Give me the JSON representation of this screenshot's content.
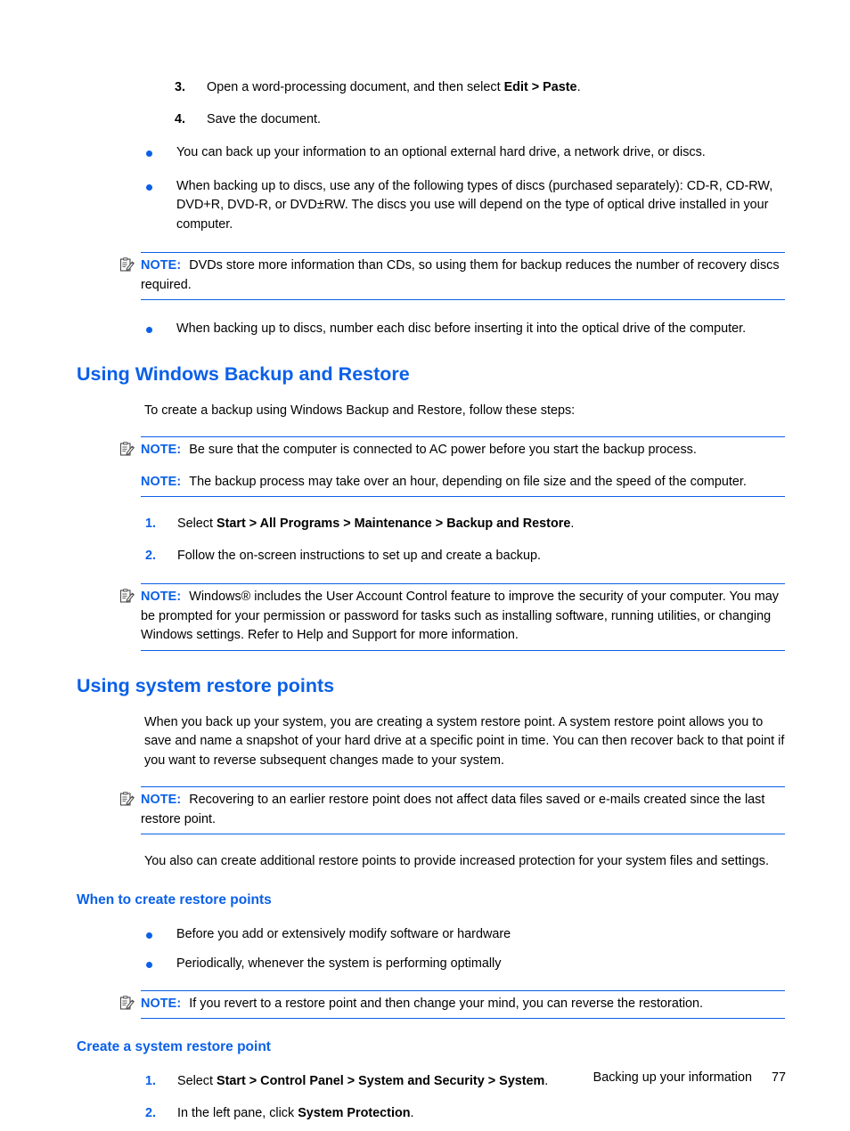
{
  "page": {
    "number": "77",
    "footer_title": "Backing up your information"
  },
  "top_steps": [
    {
      "marker": "3.",
      "text_before": "Open a word-processing document, and then select ",
      "bold": "Edit > Paste",
      "text_after": "."
    },
    {
      "marker": "4.",
      "text_before": "Save the document.",
      "bold": "",
      "text_after": ""
    }
  ],
  "top_bullets": [
    "You can back up your information to an optional external hard drive, a network drive, or discs.",
    "When backing up to discs, use any of the following types of discs (purchased separately): CD-R, CD-RW, DVD+R, DVD-R, or DVD±RW. The discs you use will depend on the type of optical drive installed in your computer."
  ],
  "note_dvd": {
    "label": "NOTE:",
    "text": "DVDs store more information than CDs, so using them for backup reduces the number of recovery discs required.",
    "icon": "note-pencil-icon"
  },
  "bullet_after_note": "When backing up to discs, number each disc before inserting it into the optical drive of the computer.",
  "section_backup_restore": {
    "heading": "Using Windows Backup and Restore",
    "intro": "To create a backup using Windows Backup and Restore, follow these steps:",
    "notes": [
      {
        "label": "NOTE:",
        "text": "Be sure that the computer is connected to AC power before you start the backup process."
      },
      {
        "label": "NOTE:",
        "text": "The backup process may take over an hour, depending on file size and the speed of the computer."
      }
    ],
    "steps": [
      {
        "marker": "1.",
        "text_before": "Select ",
        "bold": "Start > All Programs > Maintenance > Backup and Restore",
        "text_after": "."
      },
      {
        "marker": "2.",
        "text_before": "Follow the on-screen instructions to set up and create a backup.",
        "bold": "",
        "text_after": ""
      }
    ],
    "note_uac": {
      "label": "NOTE:",
      "text": "Windows® includes the User Account Control feature to improve the security of your computer. You may be prompted for your permission or password for tasks such as installing software, running utilities, or changing Windows settings. Refer to Help and Support for more information."
    }
  },
  "section_restore_points": {
    "heading": "Using system restore points",
    "paragraph_1": "When you back up your system, you are creating a system restore point. A system restore point allows you to save and name a snapshot of your hard drive at a specific point in time. You can then recover back to that point if you want to reverse subsequent changes made to your system.",
    "note": {
      "label": "NOTE:",
      "text": "Recovering to an earlier restore point does not affect data files saved or e-mails created since the last restore point."
    },
    "paragraph_2": "You also can create additional restore points to provide increased protection for your system files and settings."
  },
  "section_when_to_create": {
    "heading": "When to create restore points",
    "bullets": [
      "Before you add or extensively modify software or hardware",
      "Periodically, whenever the system is performing optimally"
    ],
    "note": {
      "label": "NOTE:",
      "text": "If you revert to a restore point and then change your mind, you can reverse the restoration."
    }
  },
  "section_create_point": {
    "heading": "Create a system restore point",
    "steps": [
      {
        "marker": "1.",
        "text_before": "Select ",
        "bold": "Start > Control Panel > System and Security > System",
        "text_after": "."
      },
      {
        "marker": "2.",
        "text_before": "In the left pane, click ",
        "bold": "System Protection",
        "text_after": "."
      }
    ]
  },
  "colors": {
    "accent_blue": "#0a60e8",
    "text_black": "#000000",
    "background": "#ffffff"
  }
}
